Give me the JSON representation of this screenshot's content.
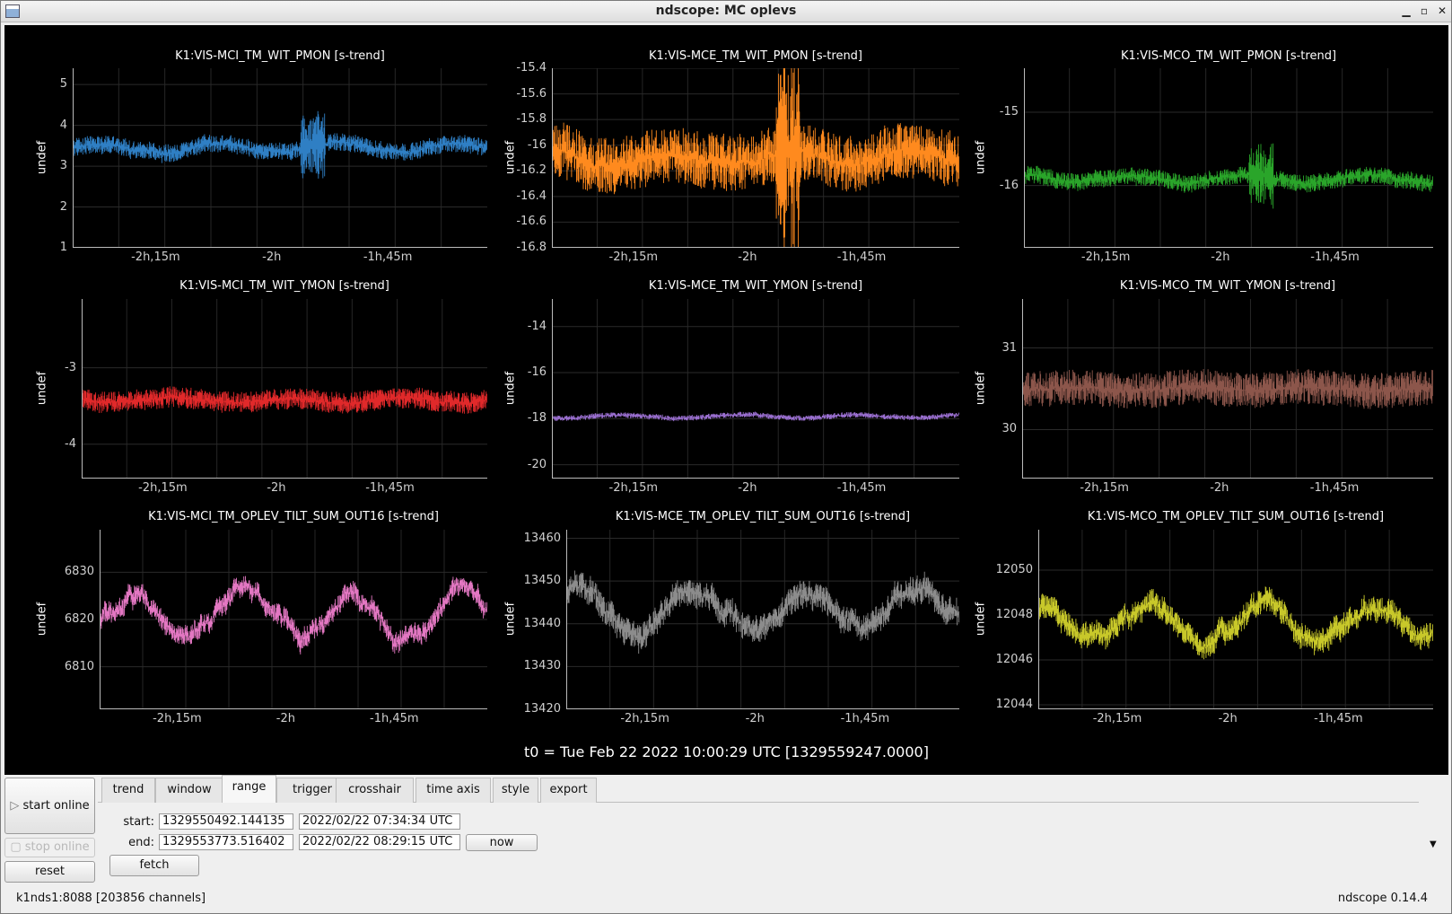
{
  "window": {
    "title": "ndscope: MC oplevs"
  },
  "t0": "t0 = Tue Feb 22 2022 10:00:29 UTC [1329559247.0000]",
  "panels": [
    {
      "title": "K1:VIS-MCI_TM_WIT_PMON [s-trend]",
      "ylabel": "undef",
      "color": "#2f7fc4",
      "yticks": [
        "5",
        "4",
        "3",
        "2",
        "1"
      ],
      "yrange": [
        1,
        5.4
      ],
      "base": 3.45,
      "noise": 0.22,
      "wave": 0.1,
      "xticks": [
        "-2h,15m",
        "-2h",
        "-1h,45m"
      ]
    },
    {
      "title": "K1:VIS-MCE_TM_WIT_PMON [s-trend]",
      "ylabel": "undef",
      "color": "#ff8a1e",
      "yticks": [
        "-15.4",
        "-15.6",
        "-15.8",
        "-16",
        "-16.2",
        "-16.4",
        "-16.6",
        "-16.8"
      ],
      "yrange": [
        -16.8,
        -15.4
      ],
      "base": -16.1,
      "noise": 0.22,
      "wave": 0.05,
      "xticks": [
        "-2h,15m",
        "-2h",
        "-1h,45m"
      ]
    },
    {
      "title": "K1:VIS-MCO_TM_WIT_PMON [s-trend]",
      "ylabel": "undef",
      "color": "#2aa52a",
      "yticks": [
        "-15",
        "-16"
      ],
      "yrange": [
        -16.85,
        -14.4
      ],
      "base": -15.9,
      "noise": 0.12,
      "wave": 0.05,
      "xticks": [
        "-2h,15m",
        "-2h",
        "-1h,45m"
      ]
    },
    {
      "title": "K1:VIS-MCI_TM_WIT_YMON [s-trend]",
      "ylabel": "undef",
      "color": "#e0292a",
      "yticks": [
        "-3",
        "-4"
      ],
      "yrange": [
        -4.45,
        -2.1
      ],
      "base": -3.42,
      "noise": 0.14,
      "wave": 0.03,
      "xticks": [
        "-2h,15m",
        "-2h",
        "-1h,45m"
      ]
    },
    {
      "title": "K1:VIS-MCE_TM_WIT_YMON [s-trend]",
      "ylabel": "undef",
      "color": "#9a6fd0",
      "yticks": [
        "-14",
        "-16",
        "-18",
        "-20"
      ],
      "yrange": [
        -20.6,
        -12.8
      ],
      "base": -17.9,
      "noise": 0.12,
      "wave": 0.08,
      "xticks": [
        "-2h,15m",
        "-2h",
        "-1h,45m"
      ]
    },
    {
      "title": "K1:VIS-MCO_TM_WIT_YMON [s-trend]",
      "ylabel": "undef",
      "color": "#8c564b",
      "yticks": [
        "31",
        "30"
      ],
      "yrange": [
        29.4,
        31.6
      ],
      "base": 30.5,
      "noise": 0.22,
      "wave": 0.02,
      "xticks": [
        "-2h,15m",
        "-2h",
        "-1h,45m"
      ]
    },
    {
      "title": "K1:VIS-MCI_TM_OPLEV_TILT_SUM_OUT16 [s-trend]",
      "ylabel": "undef",
      "color": "#e377c2",
      "yticks": [
        "6830",
        "6820",
        "6810"
      ],
      "yrange": [
        6801,
        6839
      ],
      "base": 6821,
      "noise": 2.2,
      "wave": 4.5,
      "xticks": [
        "-2h,15m",
        "-2h",
        "-1h,45m"
      ]
    },
    {
      "title": "K1:VIS-MCE_TM_OPLEV_TILT_SUM_OUT16 [s-trend]",
      "ylabel": "undef",
      "color": "#8c8c8c",
      "yticks": [
        "13460",
        "13450",
        "13440",
        "13430",
        "13420"
      ],
      "yrange": [
        13420,
        13462
      ],
      "base": 13443,
      "noise": 3.2,
      "wave": 4.5,
      "xticks": [
        "-2h,15m",
        "-2h",
        "-1h,45m"
      ]
    },
    {
      "title": "K1:VIS-MCO_TM_OPLEV_TILT_SUM_OUT16 [s-trend]",
      "ylabel": "undef",
      "color": "#c8c82a",
      "yticks": [
        "12050",
        "12048",
        "12046",
        "12044"
      ],
      "yrange": [
        12043.8,
        12051.8
      ],
      "base": 12047.6,
      "noise": 0.55,
      "wave": 0.8,
      "xticks": [
        "-2h,15m",
        "-2h",
        "-1h,45m"
      ]
    }
  ],
  "buttons": {
    "start_online": "start online",
    "stop_online": "stop online",
    "reset": "reset",
    "fetch": "fetch",
    "now": "now"
  },
  "tabs": [
    "trend",
    "window",
    "range",
    "trigger",
    "crosshair",
    "time axis",
    "style",
    "export"
  ],
  "active_tab": "range",
  "range": {
    "start_label": "start:",
    "end_label": "end:",
    "start_gps": "1329550492.144135",
    "start_utc": "2022/02/22 07:34:34 UTC",
    "end_gps": "1329553773.516402",
    "end_utc": "2022/02/22 08:29:15 UTC"
  },
  "status": {
    "server": "k1nds1:8088  [203856 channels]",
    "version": "ndscope 0.14.4"
  }
}
